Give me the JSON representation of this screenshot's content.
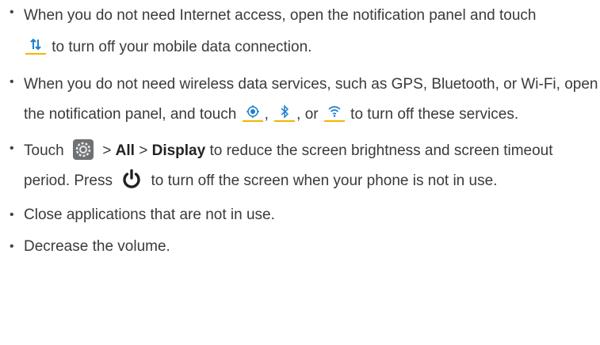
{
  "items": [
    {
      "part1": "When you do not need Internet access, open the notification panel and touch",
      "icon": "mobile-data-icon",
      "part2": "to turn off your mobile data connection."
    },
    {
      "part1": "When you do not need wireless data services, such as GPS, Bluetooth, or Wi-Fi, open the notification panel, and touch",
      "icon_a": "gps-icon",
      "sep1": ",",
      "icon_b": "bluetooth-icon",
      "sep2": ", or",
      "icon_c": "wifi-icon",
      "part2": "to turn off these services."
    },
    {
      "part1": "Touch",
      "icon_settings": "settings-icon",
      "sep1": ">",
      "all": "All",
      "sep2": ">",
      "display": "Display",
      "part2": "to reduce the screen brightness and screen timeout period. Press",
      "icon_power": "power-icon",
      "part3": "to turn off the screen when your phone is not in use."
    },
    {
      "text": "Close applications that are not in use."
    },
    {
      "text": "Decrease the volume."
    }
  ],
  "bullet": "•",
  "colors": {
    "icon_accent": "#f2b400",
    "icon_blue": "#1a7fd0",
    "text": "#3a3a3a"
  }
}
